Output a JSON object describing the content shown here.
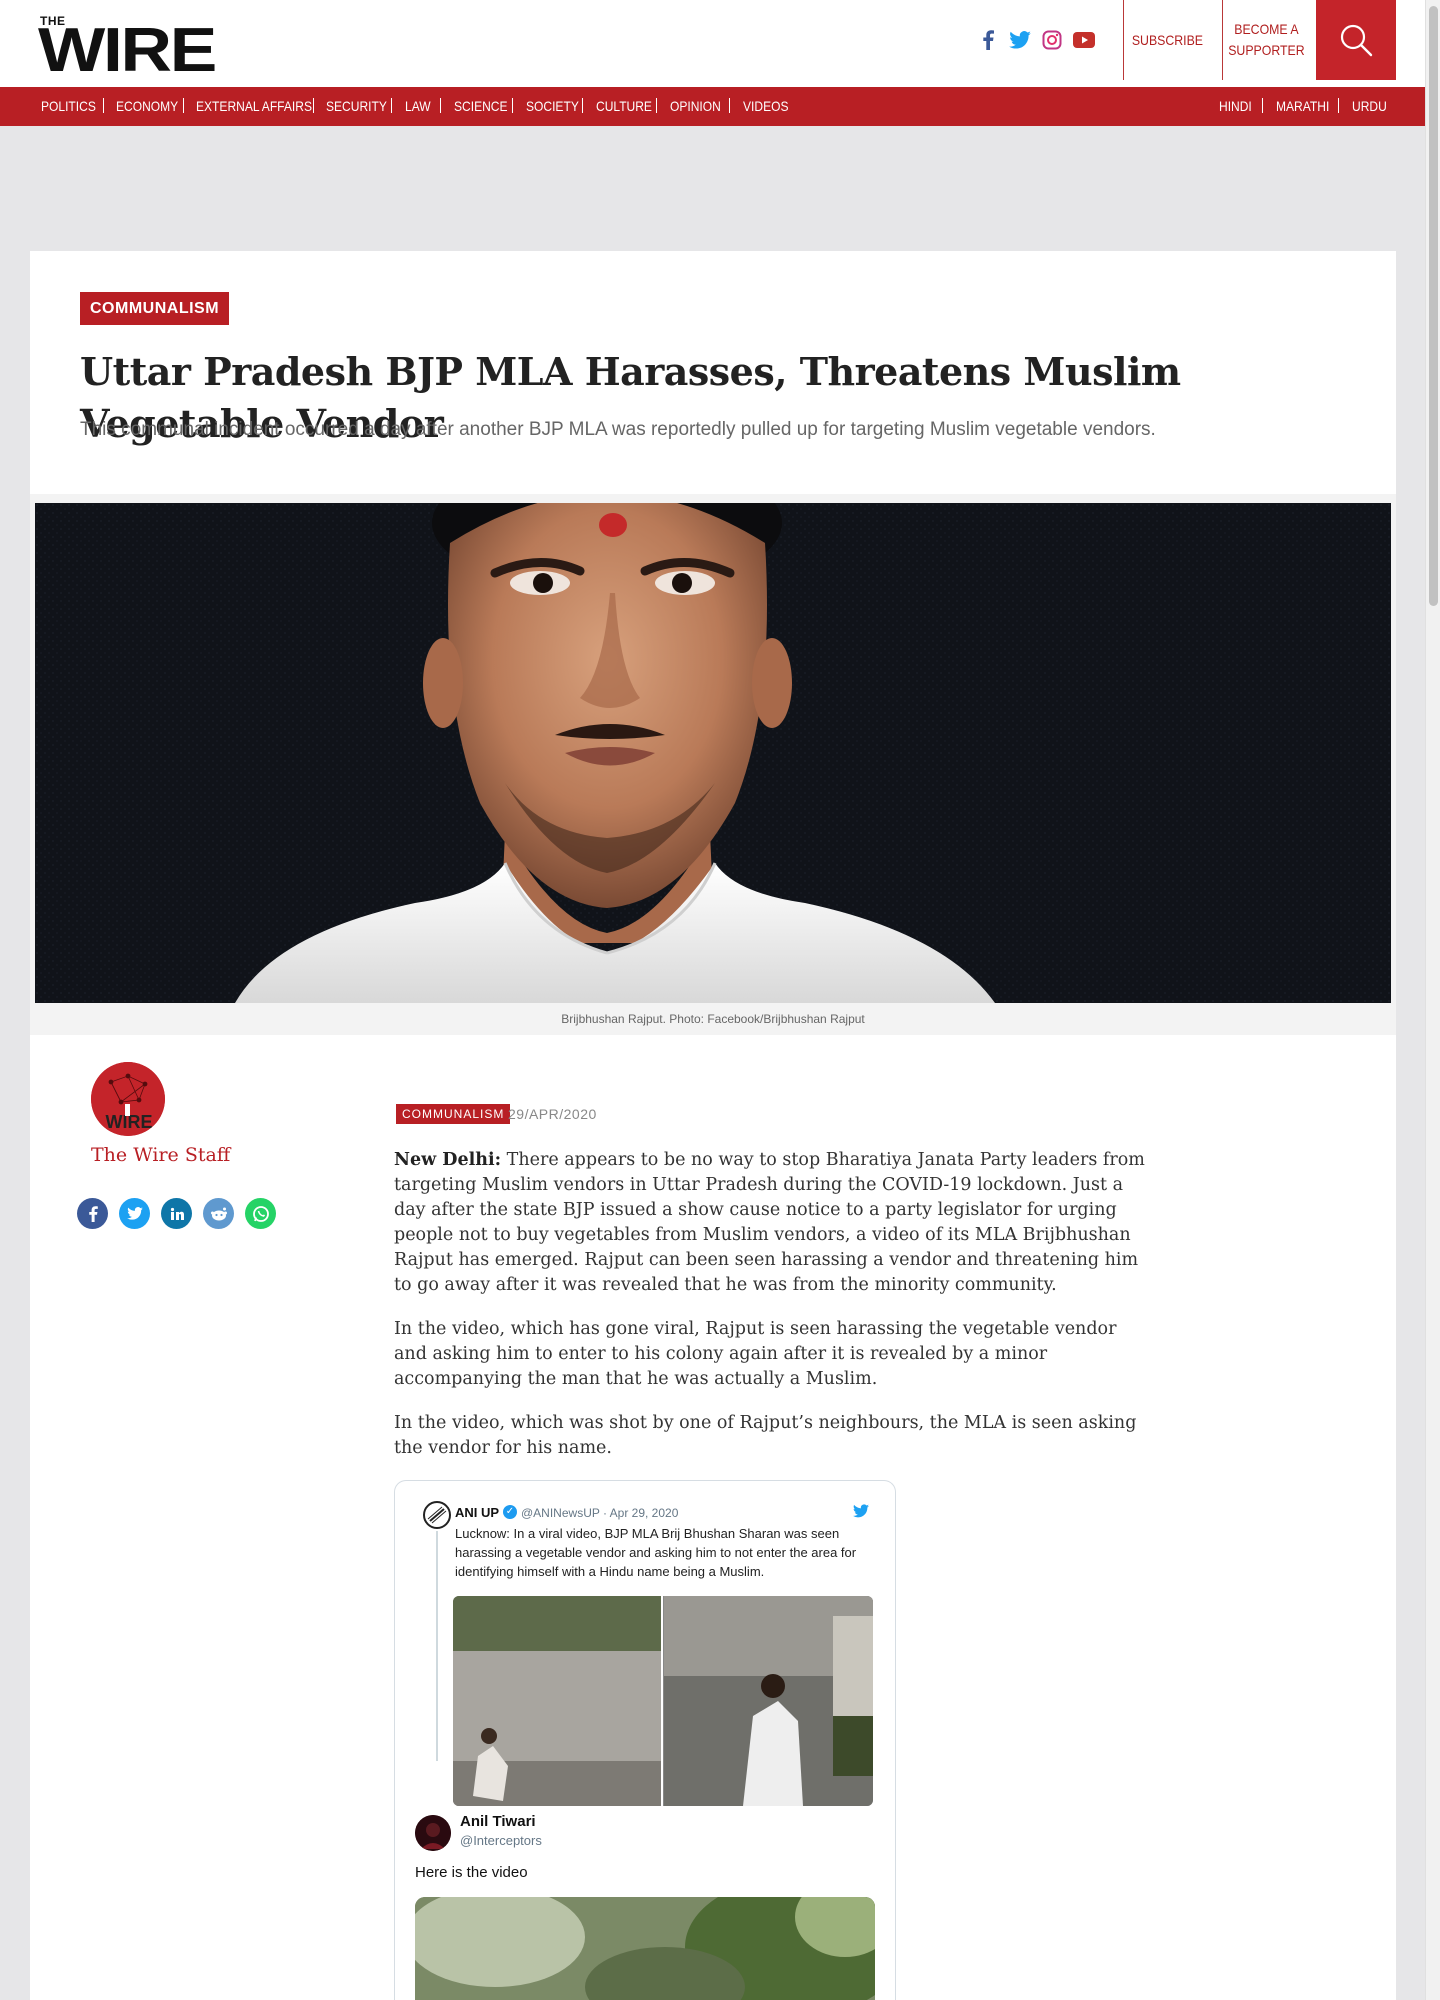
{
  "brand": {
    "the": "THE",
    "wire": "WIRE"
  },
  "header": {
    "social_icons": [
      "facebook-icon",
      "twitter-icon",
      "instagram-icon",
      "youtube-icon"
    ],
    "subscribe_label": "SUBSCRIBE",
    "supporter_label_line1": "BECOME A",
    "supporter_label_line2": "SUPPORTER",
    "search_icon": "search-icon"
  },
  "nav": {
    "left": [
      "POLITICS",
      "ECONOMY",
      "EXTERNAL AFFAIRS",
      "SECURITY",
      "LAW",
      "SCIENCE",
      "SOCIETY",
      "CULTURE",
      "OPINION",
      "VIDEOS"
    ],
    "right": [
      "HINDI",
      "MARATHI",
      "URDU"
    ]
  },
  "article": {
    "category": "COMMUNALISM",
    "title": "Uttar Pradesh BJP MLA Harasses, Threatens Muslim Vegetable Vendor",
    "subtitle": "This communal incident occurred a day after another BJP MLA was reportedly pulled up for targeting Muslim vegetable vendors.",
    "image_caption": "Brijbhushan Rajput. Photo: Facebook/Brijbhushan Rajput",
    "meta_category": "COMMUNALISM",
    "date": "29/APR/2020",
    "dateline": "New Delhi:",
    "para1": "There appears to be no way to stop Bharatiya Janata Party leaders from targeting Muslim vendors in Uttar Pradesh during the COVID-19 lockdown. Just a day after the state BJP issued a show cause notice to a party legislator for urging people not to buy vegetables from Muslim vendors, a video of its MLA Brijbhushan Rajput has emerged. Rajput can been seen harassing a vendor and threatening him to go away after it was revealed that he was from the minority community.",
    "para2": "In the video, which has gone viral, Rajput is seen harassing the vegetable vendor and asking him to enter to his colony again after it is revealed by a minor accompanying the man that he was actually a Muslim.",
    "para3": "In the video, which was shot by one of Rajput’s neighbours, the MLA is seen asking the vendor for his name."
  },
  "author": {
    "name": "The Wire Staff",
    "share_icons": [
      "facebook-share-icon",
      "twitter-share-icon",
      "linkedin-share-icon",
      "reddit-share-icon",
      "whatsapp-share-icon"
    ]
  },
  "tweet": {
    "quoted": {
      "name": "ANI UP",
      "handle": "@ANINewsUP · Apr 29, 2020",
      "text": "Lucknow: In a viral video, BJP MLA Brij Bhushan Sharan was seen harassing a vegetable vendor and asking him to not enter the area for identifying himself with a Hindu name being a Muslim."
    },
    "reply": {
      "name": "Anil Tiwari",
      "handle": "@Interceptors",
      "text": "Here is the video"
    }
  },
  "colors": {
    "brand_red": "#b81f24",
    "nav_red": "#b81f24",
    "search_red": "#c4242a"
  }
}
